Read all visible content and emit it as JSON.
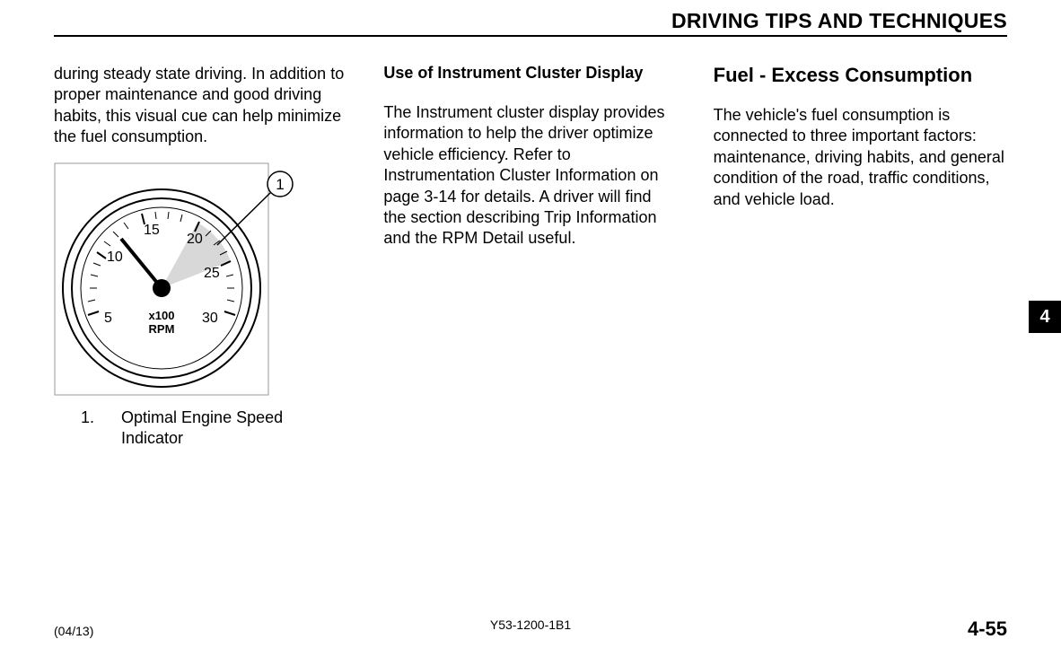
{
  "header": {
    "title": "DRIVING TIPS AND TECHNIQUES"
  },
  "col1": {
    "intro": "during steady state driving. In addition to proper maintenance and good driving habits, this visual cue can help minimize the fuel consumption.",
    "gauge": {
      "callout": "1",
      "ticks": [
        "5",
        "10",
        "15",
        "20",
        "25",
        "30"
      ],
      "unit_top": "x100",
      "unit_bottom": "RPM"
    },
    "caption_num": "1.",
    "caption_text": "Optimal Engine Speed Indicator"
  },
  "col2": {
    "subhead": "Use of Instrument Cluster Display",
    "body": "The Instrument cluster display provides information to help the driver optimize vehicle efficiency. Refer to Instrumentation Cluster Information on page 3-14 for details. A driver will find the section describing Trip Information and the RPM Detail useful."
  },
  "col3": {
    "section_head": "Fuel - Excess Consumption",
    "body": "The vehicle's fuel consumption is connected to three important factors: maintenance, driving habits, and general condition of the road, traffic conditions, and vehicle load."
  },
  "tab": {
    "number": "4"
  },
  "footer": {
    "left": "(04/13)",
    "center": "Y53-1200-1B1",
    "right": "4-55"
  }
}
